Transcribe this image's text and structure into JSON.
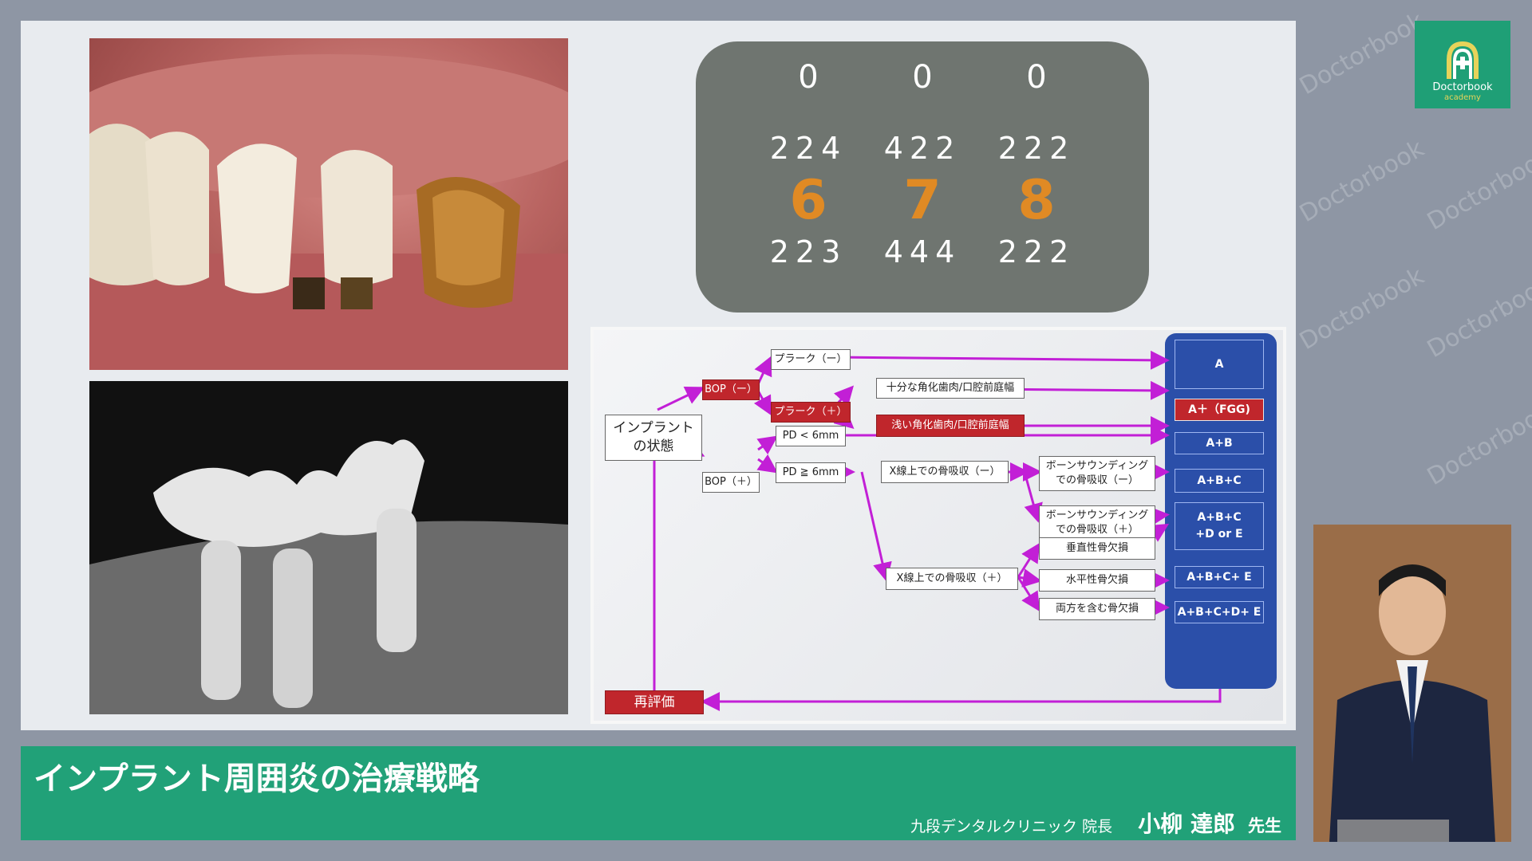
{
  "logo": {
    "name": "Doctorbook",
    "sub": "academy"
  },
  "watermark": {
    "name": "Doctorbook",
    "sub": "academy"
  },
  "dental_chart": {
    "columns": [
      {
        "top": "0",
        "upper": "224",
        "tooth": "6",
        "lower": "223"
      },
      {
        "top": "0",
        "upper": "422",
        "tooth": "7",
        "lower": "444"
      },
      {
        "top": "0",
        "upper": "222",
        "tooth": "8",
        "lower": "222"
      }
    ],
    "tooth_color": "#e08a24"
  },
  "flowchart": {
    "start": "インプラント\nの状態",
    "bop_neg": "BOP（ー）",
    "bop_pos": "BOP（＋）",
    "plaque_neg": "プラーク（ー）",
    "plaque_pos": "プラーク（＋）",
    "enough_keratinized": "十分な角化歯肉/口腔前庭幅",
    "shallow_keratinized": "浅い角化歯肉/口腔前庭幅",
    "pd_lt6": "PD < 6mm",
    "pd_ge6": "PD ≧ 6mm",
    "xray_neg": "X線上での骨吸収（ー）",
    "xray_pos": "X線上での骨吸収（＋）",
    "bone_sounding_neg": "ボーンサウンディング\nでの骨吸収（ー）",
    "bone_sounding_pos": "ボーンサウンディング\nでの骨吸収（＋）",
    "vertical_defect": "垂直性骨欠損",
    "horizontal_defect": "水平性骨欠損",
    "combined_defect": "両方を含む骨欠損",
    "reevaluation": "再評価",
    "results": [
      "A",
      "A＋（FGG)",
      "A+B",
      "A+B+C",
      "A+B+C\n+D or E",
      "A+B+C+ E",
      "A+B+C+D+ E"
    ],
    "arrow_color": "#c21fd6"
  },
  "lower_third": {
    "title": "インプラント周囲炎の治療戦略",
    "affiliation": "九段デンタルクリニック 院長",
    "speaker_name": "小柳 達郎",
    "honorific": "先生"
  },
  "colors": {
    "brand_green": "#21a178",
    "accent_red": "#c0262c",
    "panel_blue": "#2b4fa9"
  }
}
